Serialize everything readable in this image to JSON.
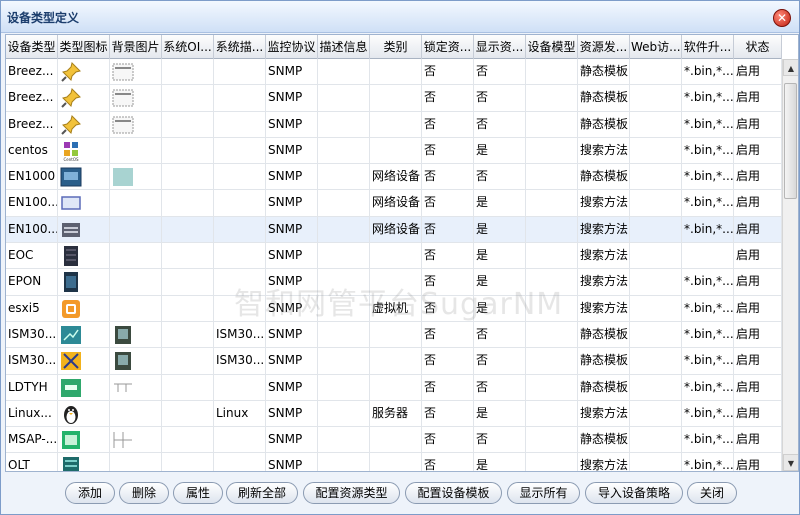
{
  "window": {
    "title": "设备类型定义"
  },
  "watermark": "智和网管平台SugarNM",
  "columns": [
    "设备类型",
    "类型图标",
    "背景图片",
    "系统OI...",
    "系统描...",
    "监控协议",
    "描述信息",
    "类别",
    "锁定资...",
    "显示资...",
    "设备模型",
    "资源发...",
    "Web访...",
    "软件升...",
    "状态"
  ],
  "rows": [
    {
      "type": "Breez...",
      "icon": "pushpin-icon",
      "bg": "panel-bg",
      "oid": "",
      "desc_sys": "",
      "protocol": "SNMP",
      "desc": "",
      "category": "",
      "lock": "否",
      "show": "否",
      "model": "",
      "discovery": "静态模板",
      "web": "",
      "firmware": "*.bin,*....",
      "status": "启用"
    },
    {
      "type": "Breez...",
      "icon": "pushpin-icon",
      "bg": "panel-bg",
      "oid": "",
      "desc_sys": "",
      "protocol": "SNMP",
      "desc": "",
      "category": "",
      "lock": "否",
      "show": "否",
      "model": "",
      "discovery": "静态模板",
      "web": "",
      "firmware": "*.bin,*....",
      "status": "启用"
    },
    {
      "type": "Breez...",
      "icon": "pushpin-icon",
      "bg": "panel-bg",
      "oid": "",
      "desc_sys": "",
      "protocol": "SNMP",
      "desc": "",
      "category": "",
      "lock": "否",
      "show": "否",
      "model": "",
      "discovery": "静态模板",
      "web": "",
      "firmware": "*.bin,*....",
      "status": "启用"
    },
    {
      "type": "centos",
      "icon": "centos-icon",
      "bg": "",
      "oid": "",
      "desc_sys": "",
      "protocol": "SNMP",
      "desc": "",
      "category": "",
      "lock": "否",
      "show": "是",
      "model": "",
      "discovery": "搜索方法",
      "web": "",
      "firmware": "*.bin,*....",
      "status": "启用"
    },
    {
      "type": "EN1000",
      "icon": "device-blue-icon",
      "bg": "device-bg",
      "oid": "",
      "desc_sys": "",
      "protocol": "SNMP",
      "desc": "",
      "category": "网络设备",
      "lock": "否",
      "show": "否",
      "model": "",
      "discovery": "静态模板",
      "web": "",
      "firmware": "*.bin,*....",
      "status": "启用"
    },
    {
      "type": "EN100...",
      "icon": "device-frame-icon",
      "bg": "",
      "oid": "",
      "desc_sys": "",
      "protocol": "SNMP",
      "desc": "",
      "category": "网络设备",
      "lock": "否",
      "show": "是",
      "model": "",
      "discovery": "搜索方法",
      "web": "",
      "firmware": "*.bin,*....",
      "status": "启用"
    },
    {
      "type": "EN100...",
      "icon": "switch-icon",
      "bg": "",
      "oid": "",
      "desc_sys": "",
      "protocol": "SNMP",
      "desc": "",
      "category": "网络设备",
      "lock": "否",
      "show": "是",
      "model": "",
      "discovery": "搜索方法",
      "web": "",
      "firmware": "*.bin,*....",
      "status": "启用"
    },
    {
      "type": "EOC",
      "icon": "rack-icon",
      "bg": "",
      "oid": "",
      "desc_sys": "",
      "protocol": "SNMP",
      "desc": "",
      "category": "",
      "lock": "否",
      "show": "是",
      "model": "",
      "discovery": "搜索方法",
      "web": "",
      "firmware": "",
      "status": "启用"
    },
    {
      "type": "EPON",
      "icon": "rack-dark-icon",
      "bg": "",
      "oid": "",
      "desc_sys": "",
      "protocol": "SNMP",
      "desc": "",
      "category": "",
      "lock": "否",
      "show": "是",
      "model": "",
      "discovery": "搜索方法",
      "web": "",
      "firmware": "*.bin,*....",
      "status": "启用"
    },
    {
      "type": "esxi5",
      "icon": "vm-icon",
      "bg": "",
      "oid": "",
      "desc_sys": "",
      "protocol": "SNMP",
      "desc": "",
      "category": "虚拟机",
      "lock": "否",
      "show": "是",
      "model": "",
      "discovery": "搜索方法",
      "web": "",
      "firmware": "*.bin,*....",
      "status": "启用"
    },
    {
      "type": "ISM30...",
      "icon": "router-teal-icon",
      "bg": "board-bg",
      "oid": "",
      "desc_sys": "ISM30...",
      "protocol": "SNMP",
      "desc": "",
      "category": "",
      "lock": "否",
      "show": "否",
      "model": "",
      "discovery": "静态模板",
      "web": "",
      "firmware": "*.bin,*....",
      "status": "启用"
    },
    {
      "type": "ISM30...",
      "icon": "crossover-icon",
      "bg": "board-bg",
      "oid": "",
      "desc_sys": "ISM30...",
      "protocol": "SNMP",
      "desc": "",
      "category": "",
      "lock": "否",
      "show": "否",
      "model": "",
      "discovery": "静态模板",
      "web": "",
      "firmware": "*.bin,*....",
      "status": "启用"
    },
    {
      "type": "LDTYH",
      "icon": "green-device-icon",
      "bg": "wire-bg",
      "oid": "",
      "desc_sys": "",
      "protocol": "SNMP",
      "desc": "",
      "category": "",
      "lock": "否",
      "show": "否",
      "model": "",
      "discovery": "静态模板",
      "web": "",
      "firmware": "*.bin,*....",
      "status": "启用"
    },
    {
      "type": "Linux...",
      "icon": "penguin-icon",
      "bg": "",
      "oid": "",
      "desc_sys": "Linux",
      "protocol": "SNMP",
      "desc": "",
      "category": "服务器",
      "lock": "否",
      "show": "是",
      "model": "",
      "discovery": "搜索方法",
      "web": "",
      "firmware": "*.bin,*....",
      "status": "启用"
    },
    {
      "type": "MSAP-...",
      "icon": "green-box-icon",
      "bg": "grid-bg",
      "oid": "",
      "desc_sys": "",
      "protocol": "SNMP",
      "desc": "",
      "category": "",
      "lock": "否",
      "show": "否",
      "model": "",
      "discovery": "静态模板",
      "web": "",
      "firmware": "*.bin,*....",
      "status": "启用"
    },
    {
      "type": "OLT",
      "icon": "olt-icon",
      "bg": "",
      "oid": "",
      "desc_sys": "",
      "protocol": "SNMP",
      "desc": "",
      "category": "",
      "lock": "否",
      "show": "是",
      "model": "",
      "discovery": "搜索方法",
      "web": "",
      "firmware": "*.bin,*....",
      "status": "启用"
    }
  ],
  "buttons": {
    "add": "添加",
    "delete": "删除",
    "props": "属性",
    "refresh": "刷新全部",
    "config_res": "配置资源类型",
    "config_tpl": "配置设备模板",
    "show_all": "显示所有",
    "import_policy": "导入设备策略",
    "close": "关闭"
  }
}
